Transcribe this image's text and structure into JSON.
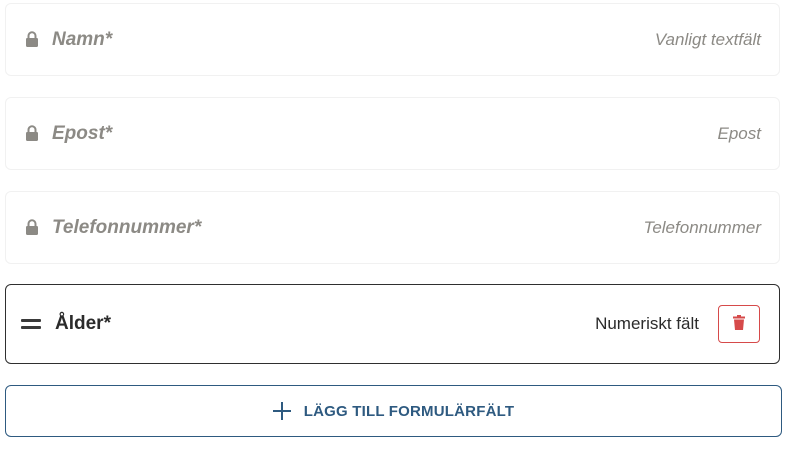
{
  "locked_fields": [
    {
      "label": "Namn*",
      "type": "Vanligt textfält",
      "icon": "lock-icon"
    },
    {
      "label": "Epost*",
      "type": "Epost",
      "icon": "lock-icon"
    },
    {
      "label": "Telefonnummer*",
      "type": "Telefonnummer",
      "icon": "lock-icon"
    }
  ],
  "custom_field": {
    "label": "Ålder*",
    "type": "Numeriskt fält",
    "drag_icon": "drag-handle-icon",
    "delete_icon": "trash-icon"
  },
  "add_button": {
    "label": "LÄGG TILL FORMULÄRFÄLT",
    "icon": "plus-icon"
  },
  "colors": {
    "locked_text": "#8c8a85",
    "delete_accent": "#d64a4a",
    "primary": "#2e5a80"
  }
}
